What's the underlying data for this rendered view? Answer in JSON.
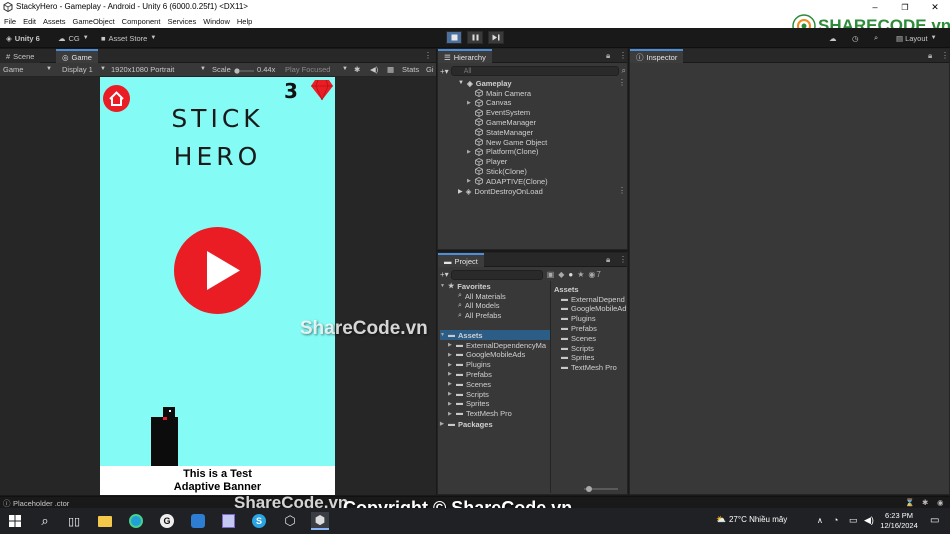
{
  "window": {
    "title": "StackyHero - Gameplay - Android - Unity 6 (6000.0.25f1) <DX11>",
    "controls": [
      "–",
      "❐",
      "✕"
    ]
  },
  "menu": [
    "File",
    "Edit",
    "Assets",
    "GameObject",
    "Component",
    "Services",
    "Window",
    "Help"
  ],
  "toolbar": {
    "unity_label": "Unity 6",
    "account": "CG",
    "asset_store": "Asset Store",
    "layout": "Layout"
  },
  "scene_tabs": {
    "scene": "Scene",
    "game": "Game"
  },
  "game_bar": {
    "mode": "Game",
    "display": "Display 1",
    "resolution": "1920x1080 Portrait",
    "scale_label": "Scale",
    "scale_value": "0.44x",
    "play_focused": "Play Focused",
    "stats": "Stats",
    "gizmos": "Gi"
  },
  "game": {
    "title_line1": "STICK",
    "title_line2": "HERO",
    "score": "3",
    "banner_line1": "This is a Test",
    "banner_line2": "Adaptive Banner",
    "colors": {
      "background": "#85fbf6",
      "accent": "#ea1c24"
    }
  },
  "hierarchy": {
    "tab": "Hierarchy",
    "search_placeholder": "All",
    "scene": "Gameplay",
    "items": [
      "Main Camera",
      "Canvas",
      "EventSystem",
      "GameManager",
      "StateManager",
      "New Game Object",
      "Platform(Clone)",
      "Player",
      "Stick(Clone)",
      "ADAPTIVE(Clone)"
    ],
    "dont_destroy": "DontDestroyOnLoad"
  },
  "project": {
    "tab": "Project",
    "hidden_count": "7",
    "favorites": "Favorites",
    "favorite_items": [
      "All Materials",
      "All Models",
      "All Prefabs"
    ],
    "assets": "Assets",
    "asset_folders": [
      "ExternalDependencyMa",
      "GoogleMobileAds",
      "Plugins",
      "Prefabs",
      "Scenes",
      "Scripts",
      "Sprites",
      "TextMesh Pro"
    ],
    "packages": "Packages",
    "right_header": "Assets",
    "right_folders": [
      "ExternalDepend",
      "GoogleMobileAd",
      "Plugins",
      "Prefabs",
      "Scenes",
      "Scripts",
      "Sprites",
      "TextMesh Pro"
    ]
  },
  "inspector": {
    "tab": "Inspector"
  },
  "status": {
    "message": "Placeholder .ctor"
  },
  "taskbar": {
    "weather": "27°C  Nhiều mây",
    "time": "6:23 PM",
    "date": "12/16/2024"
  },
  "watermarks": {
    "logo": "SHARECODE.vn",
    "center": "ShareCode.vn",
    "bottom_left": "ShareCode.vn",
    "copyright": "Copyright © ShareCode.vn"
  }
}
